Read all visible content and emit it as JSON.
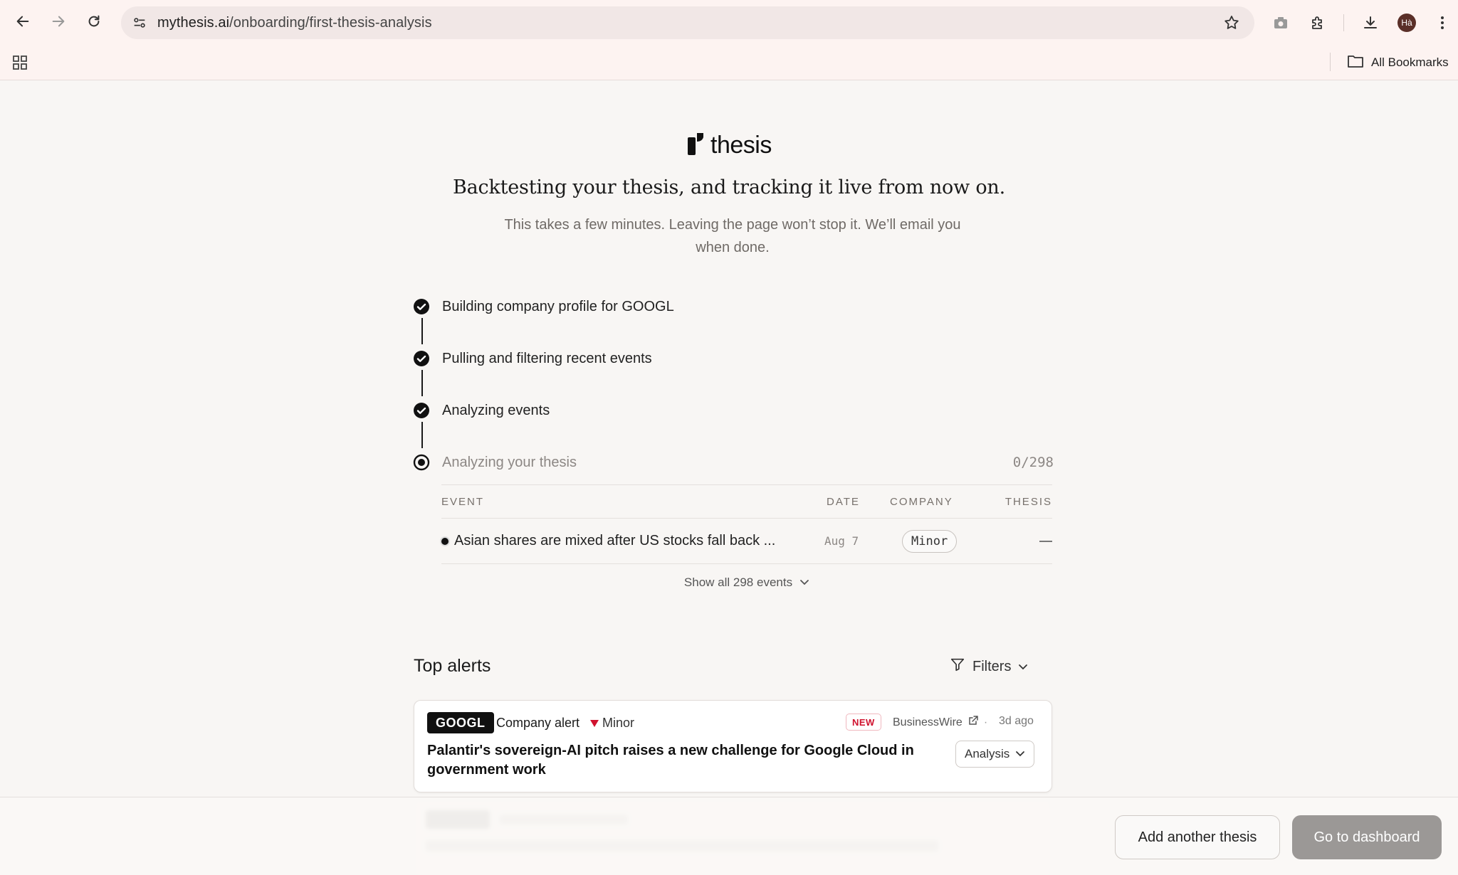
{
  "browser": {
    "url_domain": "mythesis.ai",
    "url_path": "/onboarding/first-thesis-analysis",
    "profile_initials": "Hà",
    "bookmarks_label": "All Bookmarks"
  },
  "brand": {
    "name": "thesis"
  },
  "header": {
    "headline": "Backtesting your thesis, and tracking it live from now on.",
    "subtext": "This takes a few minutes. Leaving the page won’t stop it. We’ll email you when done."
  },
  "steps": [
    {
      "label": "Building company profile for GOOGL",
      "status": "done"
    },
    {
      "label": "Pulling and filtering recent events",
      "status": "done"
    },
    {
      "label": "Analyzing events",
      "status": "done"
    },
    {
      "label": "Analyzing your thesis",
      "status": "in-progress",
      "progress_text": "0/298"
    }
  ],
  "events_table": {
    "columns": [
      "EVENT",
      "DATE",
      "COMPANY",
      "THESIS"
    ],
    "rows": [
      {
        "event": "Asian shares are mixed after US stocks fall back ...",
        "date": "Aug 7",
        "company": "Minor",
        "thesis": "—"
      }
    ],
    "show_all_label": "Show all 298 events"
  },
  "top_alerts": {
    "title": "Top alerts",
    "filters_label": "Filters",
    "alerts": [
      {
        "ticker": "GOOGL",
        "type": "Company alert",
        "severity": "Minor",
        "badge": "NEW",
        "source": "BusinessWire",
        "age_sep": "·",
        "age": "3d ago",
        "title": "Palantir's sovereign-AI pitch raises a new challenge for Google Cloud in government work",
        "action_label": "Analysis"
      }
    ]
  },
  "footer": {
    "add_label": "Add another thesis",
    "dashboard_label": "Go to dashboard"
  },
  "colors": {
    "severity_red": "#d0122e",
    "brand_dark": "#111111",
    "disabled_button": "#9b9896"
  }
}
